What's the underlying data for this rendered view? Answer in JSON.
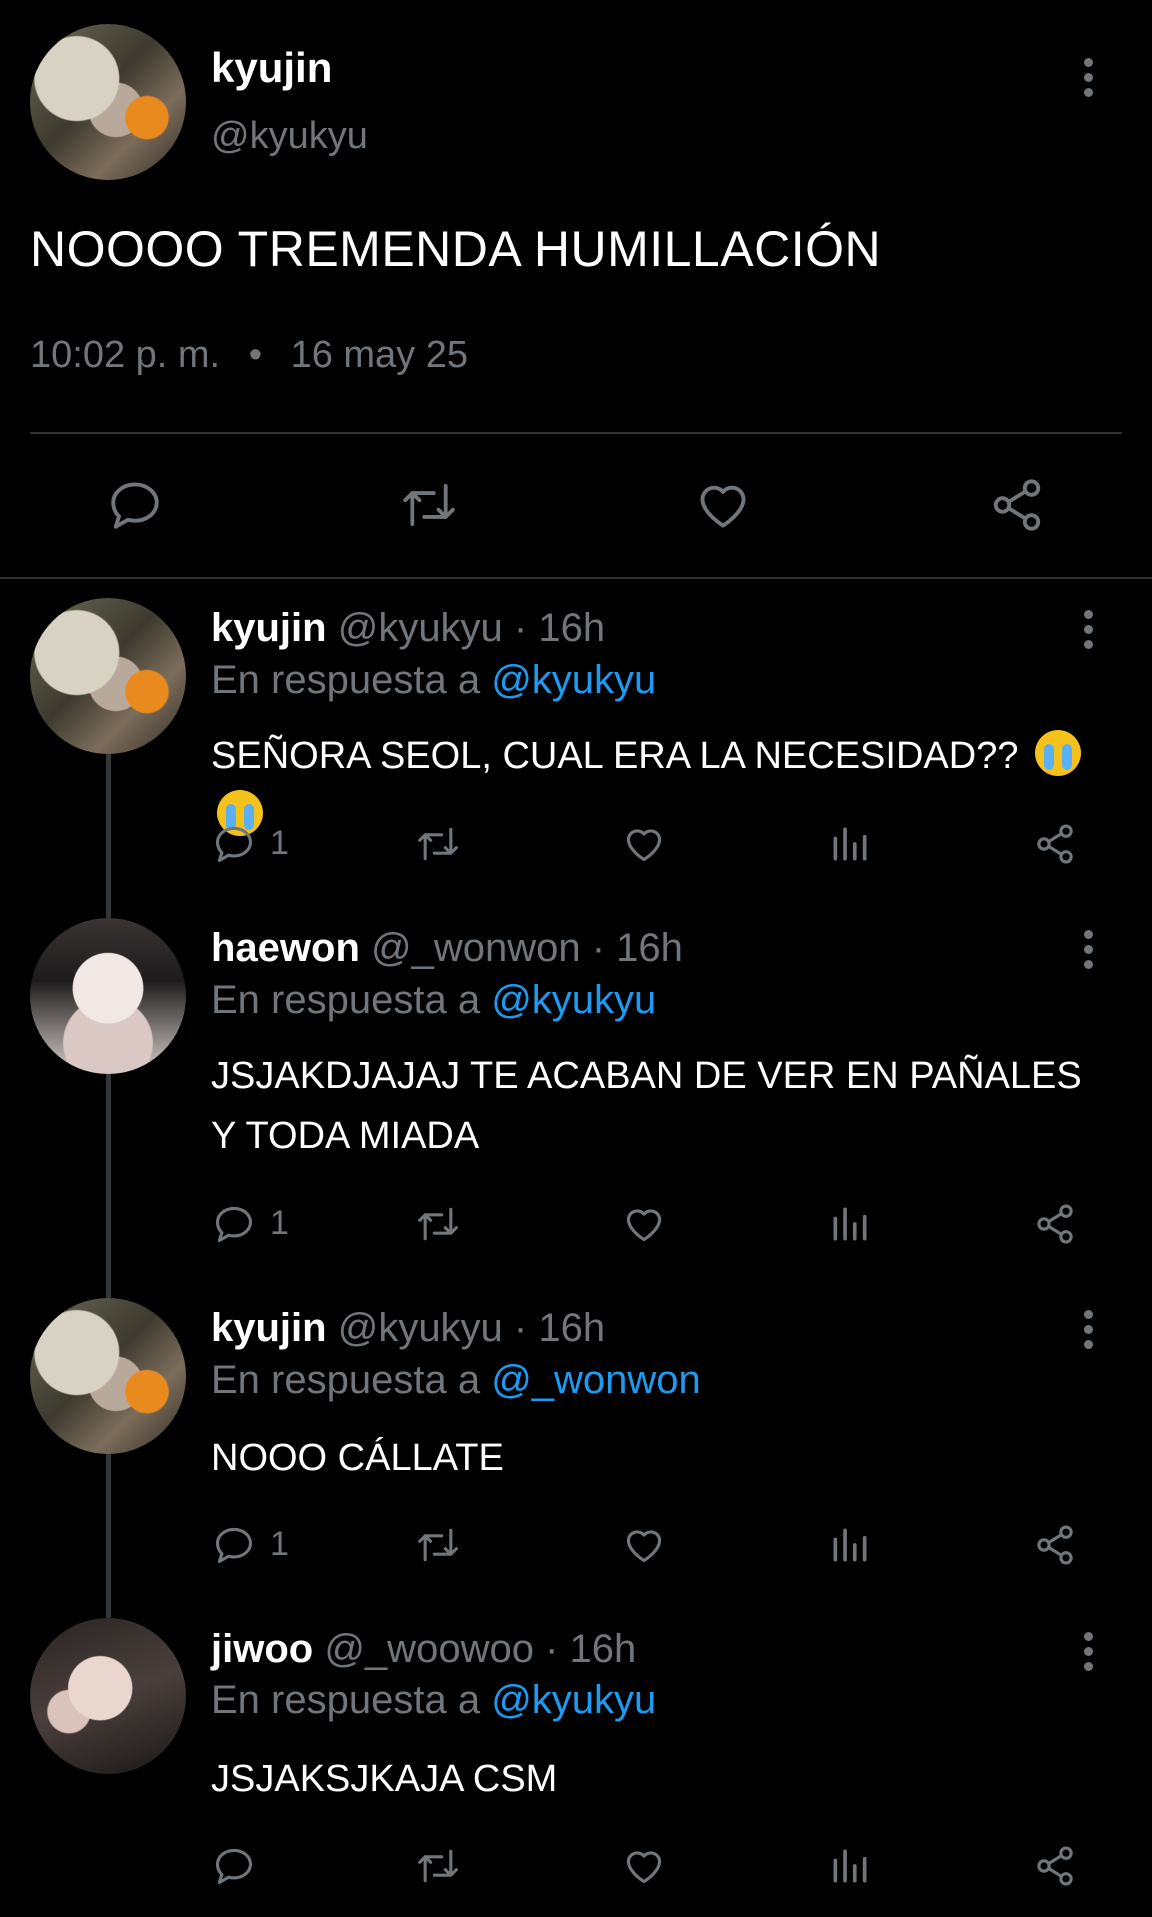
{
  "post": {
    "name": "kyujin",
    "handle": "@kyukyu",
    "text": "NOOOO TREMENDA HUMILLACIÓN",
    "time": "10:02 p. m.",
    "dot": "•",
    "date": "16 may 25"
  },
  "replies": [
    {
      "name": "kyujin",
      "handle_time": " @kyukyu · 16h",
      "reply_prefix": "En respuesta a ",
      "reply_to": "@kyukyu",
      "text": "SEÑORA SEOL, CUAL ERA LA NECESIDAD?? ",
      "reply_count": "1"
    },
    {
      "name": "haewon",
      "handle_time": " @_wonwon · 16h",
      "reply_prefix": "En respuesta a ",
      "reply_to": "@kyukyu",
      "text": "JSJAKDJAJAJ TE ACABAN DE VER EN PAÑALES Y TODA MIADA",
      "reply_count": "1"
    },
    {
      "name": "kyujin",
      "handle_time": " @kyukyu · 16h",
      "reply_prefix": "En respuesta a ",
      "reply_to": "@_wonwon",
      "text": "NOOO CÁLLATE",
      "reply_count": "1"
    },
    {
      "name": "jiwoo",
      "handle_time": " @_woowoo · 16h",
      "reply_prefix": "En respuesta a ",
      "reply_to": "@kyukyu",
      "text": "JSJAKSJKAJA CSM",
      "reply_count": ""
    }
  ],
  "icons": {
    "reply": "speech-bubble",
    "retweet": "retweet-arrows",
    "like": "heart",
    "views": "bar-chart",
    "share": "share-nodes",
    "more": "vertical-dots",
    "emoji": "loudly-crying-face"
  },
  "colors": {
    "background": "#000000",
    "text": "#ffffff",
    "muted": "#71767b",
    "link": "#1d9bf0",
    "divider": "#2f3336"
  }
}
